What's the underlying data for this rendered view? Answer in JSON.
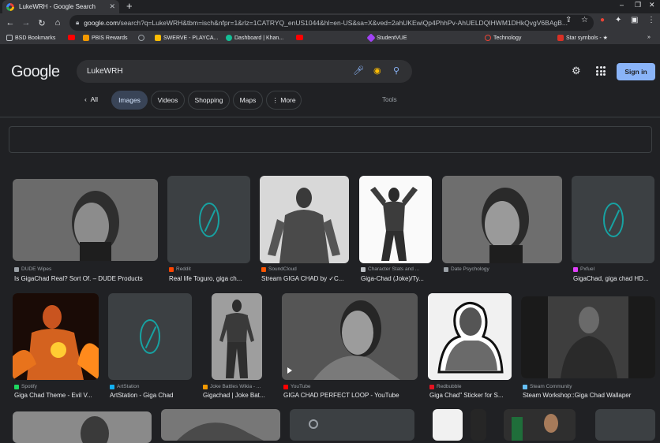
{
  "browser": {
    "tab_title": "LukeWRH - Google Search",
    "tab_close": "✕",
    "new_tab": "+",
    "url_host": "google.com",
    "url_rest": "/search?q=LukeWRH&tbm=isch&nfpr=1&rlz=1CATRYQ_enUS1044&hl=en-US&sa=X&ved=2ahUKEwiQp4PhhPv-AhUELDQIHWM1DHkQvgV6BAgB...",
    "bookmarks": [
      {
        "label": "BSD Bookmarks",
        "color": "#bdc1c6"
      },
      {
        "label": "",
        "color": "#ff0000"
      },
      {
        "label": "PBIS Rewards",
        "color": "#f29900"
      },
      {
        "label": "",
        "color": "#9aa0a6"
      },
      {
        "label": "SWERVE - PLAYCA...",
        "color": "#fbbc04"
      },
      {
        "label": "Dashboard | Khan...",
        "color": "#14bf96"
      },
      {
        "label": "",
        "color": "#ff0000"
      },
      {
        "label": "StudentVUE",
        "color": "#a142f4"
      },
      {
        "label": "Technology",
        "color": "#ea4335"
      },
      {
        "label": "Star symbols - ★",
        "color": "#d93025"
      }
    ],
    "more_bookmarks": "»"
  },
  "header": {
    "logo": "Google",
    "query": "LukeWRH",
    "signin": "Sign in"
  },
  "search_tabs": {
    "all": "All",
    "items": [
      "Images",
      "Videos",
      "Shopping",
      "Maps",
      "More"
    ],
    "tools": "Tools"
  },
  "results": [
    {
      "source": "DUDE Wipes",
      "title": "Is GigaChad Real? Sort Of. – DUDE Products",
      "fav": "#9aa0a6"
    },
    {
      "source": "Reddit",
      "title": "Real life Toguro, giga ch...",
      "fav": "#ff4500"
    },
    {
      "source": "SoundCloud",
      "title": "Stream GIGA CHAD by ✓C...",
      "fav": "#ff5500"
    },
    {
      "source": "Character Stats and ...",
      "title": "Giga-Chad (Joke)/Ty...",
      "fav": "#bdc1c6"
    },
    {
      "source": "Date Psychology",
      "title": "",
      "fav": "#9aa0a6"
    },
    {
      "source": "Pxfuel",
      "title": "GigaChad, giga chad HD...",
      "fav": "#e040fb"
    },
    {
      "source": "Spotify",
      "title": "Giga Chad Theme - Evil V...",
      "fav": "#1ed760"
    },
    {
      "source": "ArtStation",
      "title": "ArtStation - Giga Chad",
      "fav": "#13aff0"
    },
    {
      "source": "Joke Battles Wikia - ...",
      "title": "Gigachad | Joke Bat...",
      "fav": "#f29900"
    },
    {
      "source": "YouTube",
      "title": "GIGA CHAD PERFECT LOOP - YouTube",
      "fav": "#ff0000"
    },
    {
      "source": "Redbubble",
      "title": "Giga Chad\" Sticker for S...",
      "fav": "#e41321"
    },
    {
      "source": "Steam Community",
      "title": "Steam Workshop::Giga Chad Wallaper",
      "fav": "#66c0f4"
    }
  ]
}
